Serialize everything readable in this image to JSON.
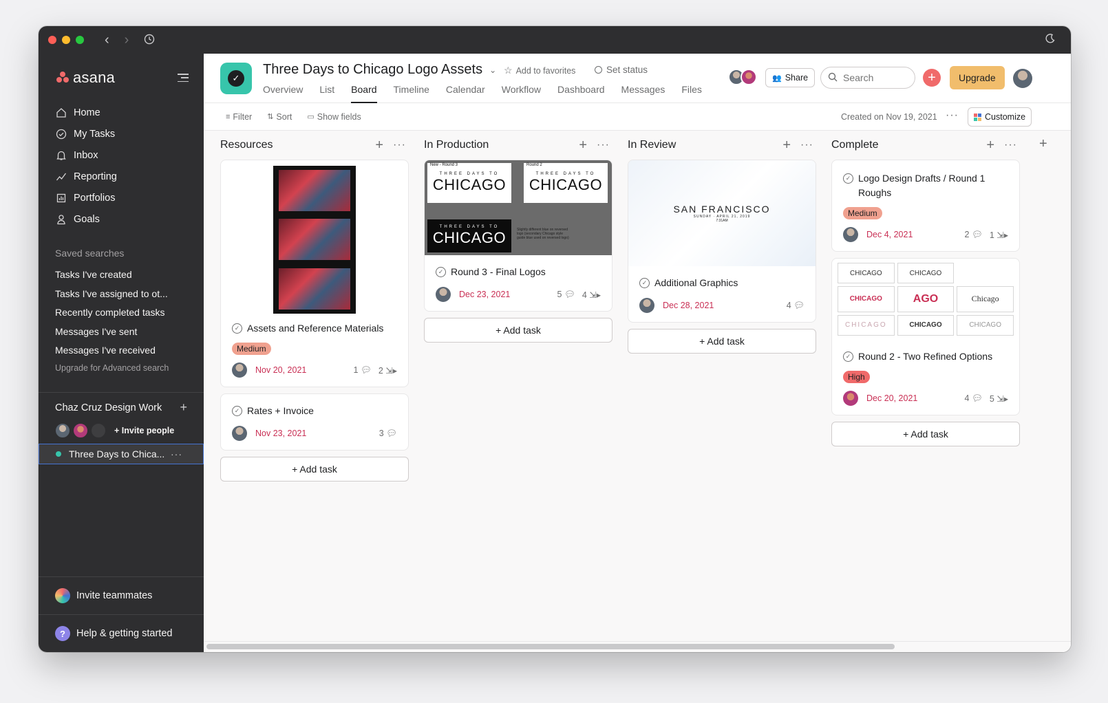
{
  "window": {
    "traffic_colors": [
      "#ff5f57",
      "#febc2e",
      "#28c840"
    ]
  },
  "sidebar": {
    "logo": "asana",
    "nav": [
      {
        "label": "Home",
        "icon": "home-icon"
      },
      {
        "label": "My Tasks",
        "icon": "check-circle-icon"
      },
      {
        "label": "Inbox",
        "icon": "bell-icon"
      },
      {
        "label": "Reporting",
        "icon": "chart-line-icon"
      },
      {
        "label": "Portfolios",
        "icon": "portfolio-icon"
      },
      {
        "label": "Goals",
        "icon": "person-icon"
      }
    ],
    "saved_title": "Saved searches",
    "saved": [
      "Tasks I've created",
      "Tasks I've assigned to ot...",
      "Recently completed tasks",
      "Messages I've sent",
      "Messages I've received"
    ],
    "upgrade_link": "Upgrade for Advanced search",
    "team_name": "Chaz Cruz Design Work",
    "invite_people": "Invite people",
    "project": "Three Days to Chica...",
    "invite_teammates": "Invite teammates",
    "help": "Help & getting started"
  },
  "header": {
    "title": "Three Days to Chicago Logo Assets",
    "favorites": "Add to favorites",
    "status": "Set status",
    "tabs": [
      "Overview",
      "List",
      "Board",
      "Timeline",
      "Calendar",
      "Workflow",
      "Dashboard",
      "Messages",
      "Files"
    ],
    "active_tab": "Board",
    "share": "Share",
    "search_placeholder": "Search",
    "upgrade": "Upgrade",
    "accent": "#37c5ab",
    "upgrade_color": "#f1bd6c"
  },
  "toolbar": {
    "filter": "Filter",
    "sort": "Sort",
    "show_fields": "Show fields",
    "created": "Created on Nov 19, 2021",
    "customize": "Customize"
  },
  "board": {
    "add_task": "+ Add task",
    "columns": [
      {
        "name": "Resources",
        "cards": [
          {
            "title": "Assets and Reference Materials",
            "tag": "Medium",
            "date": "Nov 20, 2021",
            "comments": "1",
            "subtasks": "2"
          },
          {
            "title": "Rates + Invoice",
            "date": "Nov 23, 2021",
            "comments": "3"
          }
        ]
      },
      {
        "name": "In Production",
        "cards": [
          {
            "title": "Round 3 - Final Logos",
            "date": "Dec 23, 2021",
            "comments": "5",
            "subtasks": "4",
            "image": {
              "label_new": "New - Round 3",
              "label_r2": "Round 2",
              "small": "THREE DAYS TO",
              "big": "CHICAGO",
              "note": "Slightly different blue on reversed logo (secondary Chicago style guide blue used on reversed logo)"
            }
          }
        ]
      },
      {
        "name": "In Review",
        "cards": [
          {
            "title": "Additional Graphics",
            "date": "Dec 28, 2021",
            "comments": "4",
            "image": {
              "headline": "SAN FRANCISCO",
              "sub": "SUNDAY · APRIL 21, 2019",
              "time": "7:31AM"
            }
          }
        ]
      },
      {
        "name": "Complete",
        "cards": [
          {
            "title": "Logo Design Drafts / Round 1 Roughs",
            "tag": "Medium",
            "date": "Dec 4, 2021",
            "comments": "2",
            "subtasks": "1"
          },
          {
            "title": "Round 2 - Two Refined Options",
            "tag": "High",
            "date": "Dec 20, 2021",
            "comments": "4",
            "subtasks": "5",
            "image": {
              "cells": [
                "CHICAGO",
                "CHICAGO",
                "CHICAGO",
                "AGO",
                "Chicago",
                "CHICAGO",
                "CHICAGO",
                "CHICAGO"
              ]
            }
          }
        ]
      }
    ],
    "tag_colors": {
      "Medium": "#f0a18f",
      "High": "#f06a6a"
    }
  }
}
